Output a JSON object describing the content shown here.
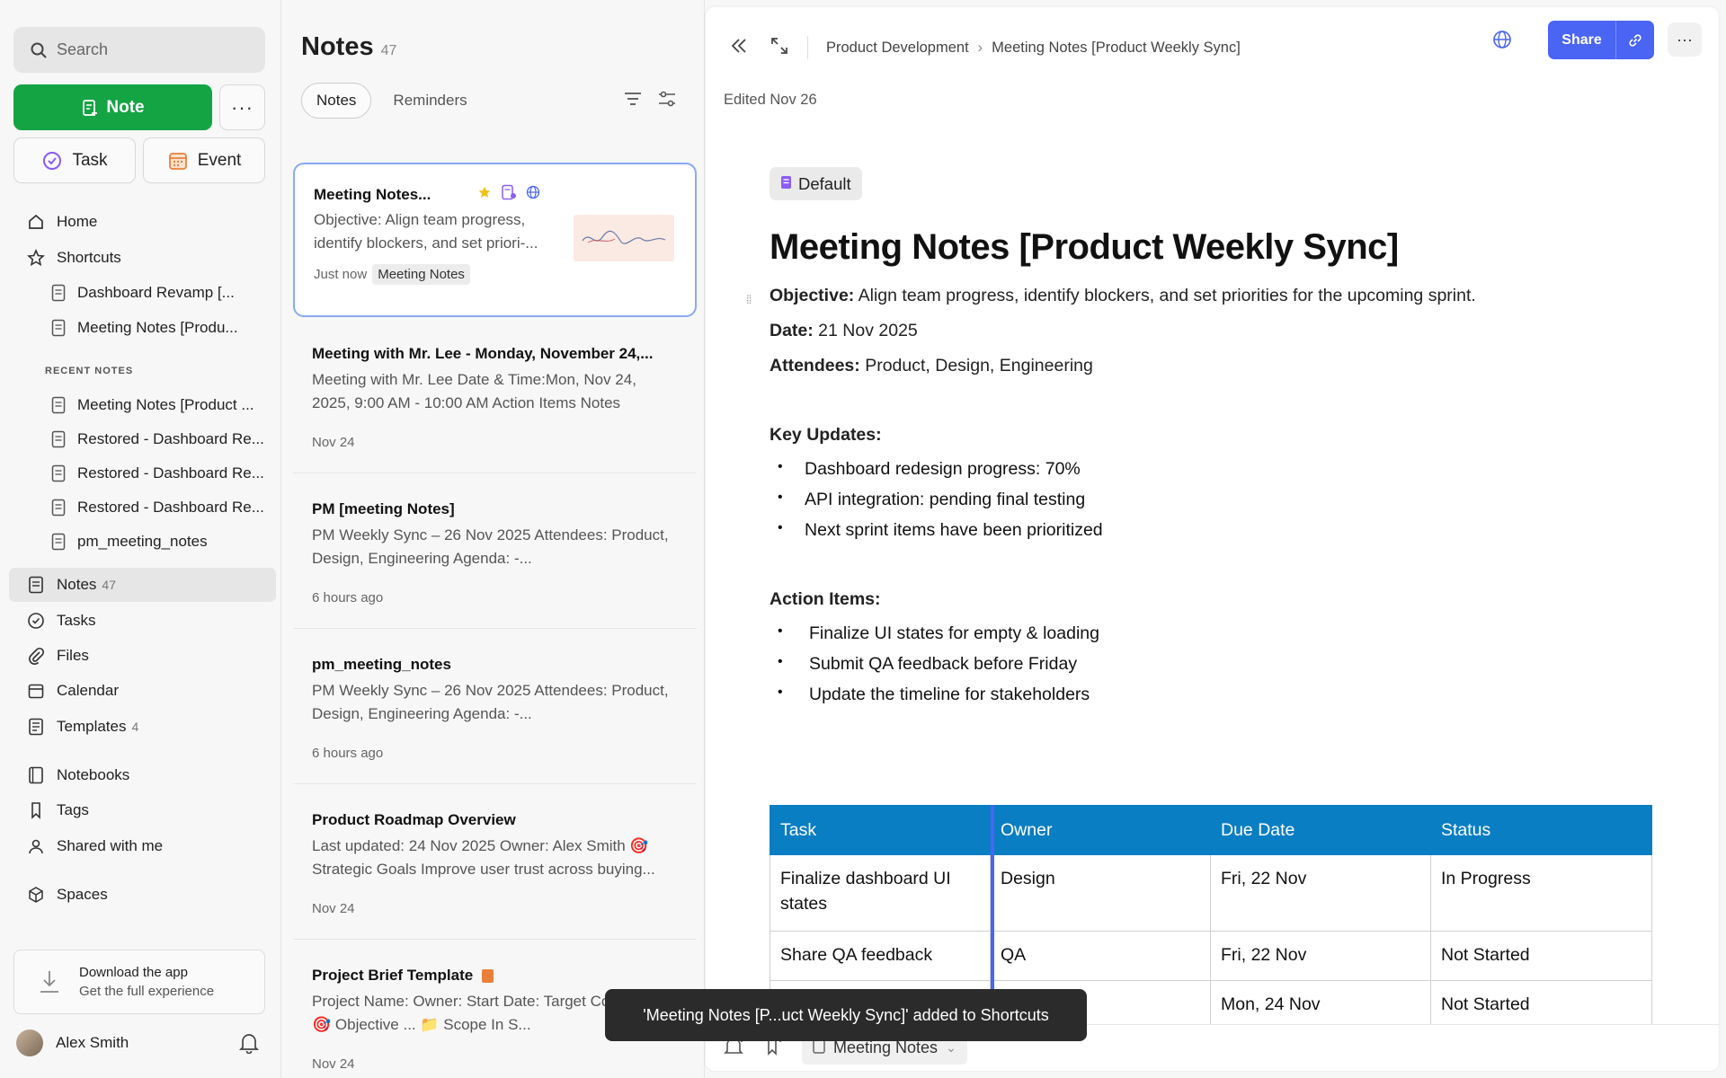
{
  "sidebar": {
    "search_placeholder": "Search",
    "note_btn": "Note",
    "task_btn": "Task",
    "event_btn": "Event",
    "home": "Home",
    "shortcuts": "Shortcuts",
    "shortcut_items": [
      "Dashboard Revamp [...",
      "Meeting Notes [Produ..."
    ],
    "recent_label": "RECENT NOTES",
    "recent_items": [
      "Meeting Notes [Product ...",
      "Restored - Dashboard Re...",
      "Restored - Dashboard Re...",
      "Restored - Dashboard Re...",
      "pm_meeting_notes"
    ],
    "notes": "Notes",
    "notes_count": "47",
    "tasks": "Tasks",
    "files": "Files",
    "calendar": "Calendar",
    "templates": "Templates",
    "templates_count": "4",
    "notebooks": "Notebooks",
    "tags": "Tags",
    "shared": "Shared with me",
    "spaces": "Spaces",
    "download_title": "Download the app",
    "download_sub": "Get the full experience",
    "user_name": "Alex Smith"
  },
  "list": {
    "title": "Notes",
    "count": "47",
    "tab_notes": "Notes",
    "tab_reminders": "Reminders",
    "cards": [
      {
        "title": "Meeting Notes...",
        "preview": "Objective: Align team progress, identify blockers, and set priori-...",
        "date": "Just now",
        "tag": "Meeting Notes"
      },
      {
        "title": "Meeting with Mr. Lee - Monday, November 24,...",
        "preview": "Meeting with Mr. Lee Date & Time:Mon, Nov 24, 2025, 9:00 AM - 10:00 AM Action Items Notes",
        "date": "Nov 24"
      },
      {
        "title": "PM [meeting Notes]",
        "preview": "PM Weekly Sync – 26 Nov 2025 Attendees: Product, Design, Engineering Agenda: -...",
        "date": "6 hours ago"
      },
      {
        "title": "pm_meeting_notes",
        "preview": "PM Weekly Sync – 26 Nov 2025 Attendees: Product, Design, Engineering Agenda: -...",
        "date": "6 hours ago"
      },
      {
        "title": "Product Roadmap Overview",
        "preview": "Last updated: 24 Nov 2025 Owner: Alex Smith 🎯 Strategic Goals Improve user trust across buying...",
        "date": "Nov 24"
      },
      {
        "title": "Project Brief Template",
        "preview": "Project Name: Owner: Start Date: Target Completion: 🎯 Objective ... 📁 Scope In S...",
        "date": "Nov 24"
      }
    ]
  },
  "editor": {
    "breadcrumb": [
      "Product Development",
      "Meeting Notes [Product Weekly Sync]"
    ],
    "share": "Share",
    "edited": "Edited Nov 26",
    "template_badge": "Default",
    "title": "Meeting Notes [Product Weekly Sync]",
    "objective_label": "Objective:",
    "objective": " Align team progress, identify blockers, and set priorities for the upcoming sprint.",
    "date_label": "Date:",
    "date": " 21 Nov 2025",
    "attendees_label": "Attendees:",
    "attendees": " Product, Design, Engineering",
    "key_updates": "Key Updates:",
    "updates": [
      "Dashboard redesign progress: 70%",
      "API integration: pending final testing",
      "Next sprint items have been prioritized"
    ],
    "action_items": "Action Items:",
    "actions": [
      "Finalize UI states for empty & loading",
      "Submit QA feedback before Friday",
      "Update the timeline for stakeholders"
    ],
    "table_headers": [
      "Task",
      "Owner",
      "Due Date",
      "Status"
    ],
    "table_rows": [
      [
        "Finalize dashboard UI states",
        "Design",
        "Fri, 22 Nov",
        "In Progress"
      ],
      [
        "Share QA feedback",
        "QA",
        "Fri, 22 Nov",
        "Not Started"
      ],
      [
        "",
        "",
        "Mon, 24 Nov",
        "Not Started"
      ]
    ],
    "notebook_chip": "Meeting Notes"
  },
  "toast": "'Meeting Notes [P...uct Weekly Sync]' added to Shortcuts",
  "colors": {
    "accent": "#4a64f4",
    "green": "#14a444",
    "table_header": "#0a7ec2"
  }
}
